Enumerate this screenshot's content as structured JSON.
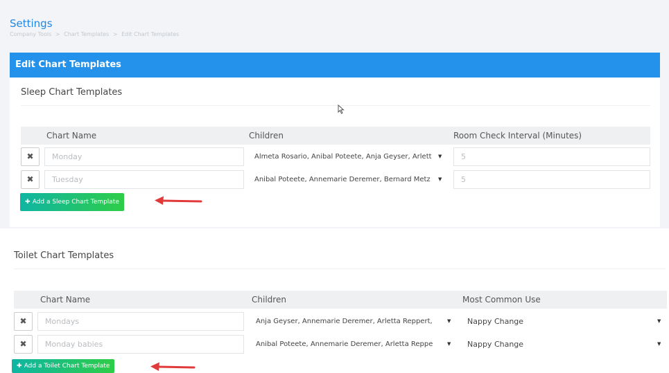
{
  "header": {
    "title": "Settings",
    "breadcrumb": [
      "Company Tools",
      ">",
      "Chart Templates",
      ">",
      "Edit Chart Templates"
    ]
  },
  "card": {
    "title": "Edit Chart Templates"
  },
  "sleep": {
    "section_title": "Sleep Chart Templates",
    "columns": [
      "Chart Name",
      "Children",
      "Room Check Interval (Minutes)"
    ],
    "rows": [
      {
        "name": "Monday",
        "children": "Almeta Rosario, Anibal Poteete, Anja Geyser, Arlett",
        "interval": "5"
      },
      {
        "name": "Tuesday",
        "children": "Anibal Poteete, Annemarie Deremer, Bernard Metz",
        "interval": "5"
      }
    ],
    "add_label": "Add a Sleep Chart Template"
  },
  "toilet": {
    "section_title": "Toilet Chart Templates",
    "columns": [
      "Chart Name",
      "Children",
      "Most Common Use"
    ],
    "rows": [
      {
        "name": "Mondays",
        "children": "Anja Geyser, Annemarie Deremer, Arletta Reppert,",
        "use": "Nappy Change"
      },
      {
        "name": "Monday babies",
        "children": "Anibal Poteete, Annemarie Deremer, Arletta Reppe",
        "use": "Nappy Change"
      }
    ],
    "add_label": "Add a Toilet Chart Template"
  },
  "icons": {
    "delete": "close-icon",
    "add": "plus-icon",
    "caret": "caret-down-icon",
    "annotation": "red-arrow-icon",
    "cursor": "mouse-cursor-icon"
  },
  "colors": {
    "primary": "#2492ea",
    "title": "#1e88e5",
    "add_button_start": "#0fb5a3",
    "add_button_end": "#2ecd47",
    "annotation_arrow": "#e03a3a"
  }
}
